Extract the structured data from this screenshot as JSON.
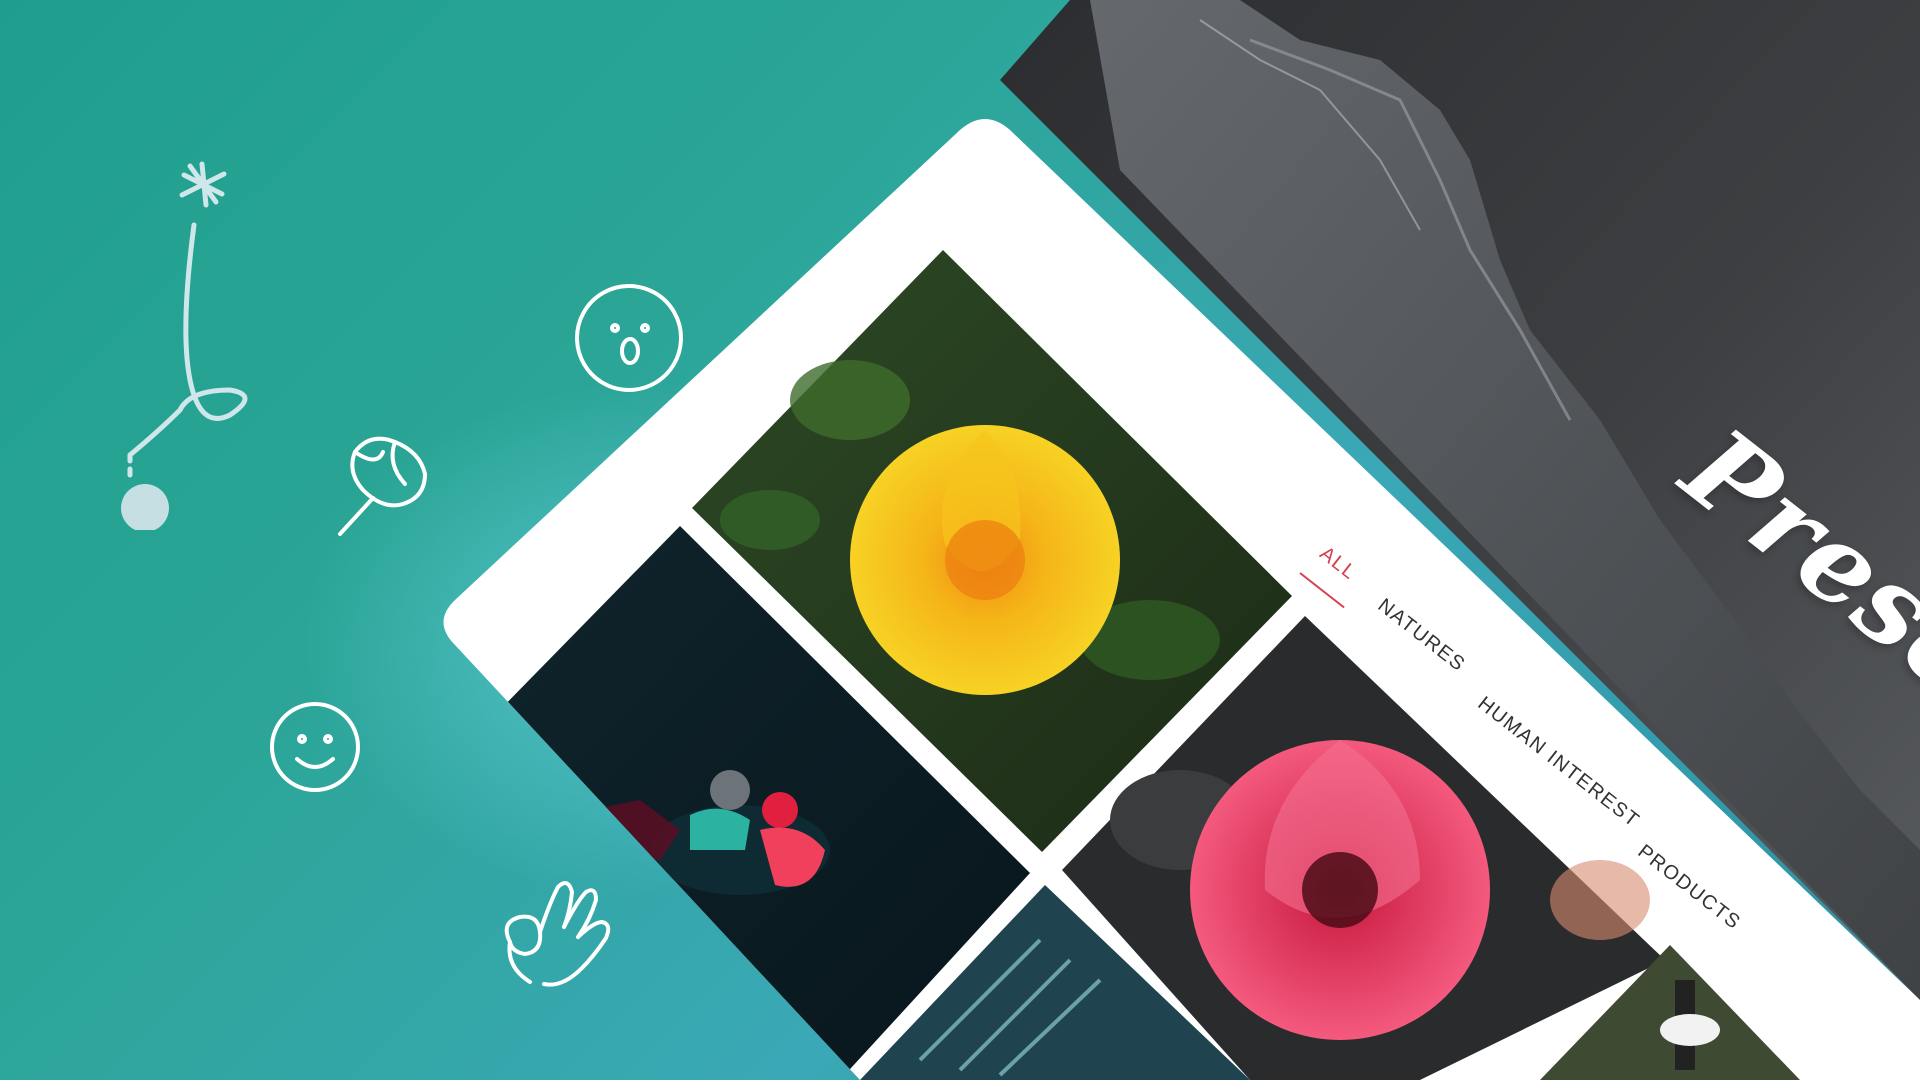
{
  "hero": {
    "title": "Presents"
  },
  "gallery": {
    "tabs": [
      {
        "label": "ALL",
        "active": true
      },
      {
        "label": "NATURES",
        "active": false
      },
      {
        "label": "HUMAN INTEREST",
        "active": false
      },
      {
        "label": "PRODUCTS",
        "active": false
      }
    ],
    "photos": [
      {
        "subject": "yellow-rose"
      },
      {
        "subject": "scooter-riders"
      },
      {
        "subject": "pink-rose"
      },
      {
        "subject": "machinery"
      },
      {
        "subject": "potted-plant"
      }
    ]
  },
  "doodles": [
    "sparkle-trail-icon",
    "surprised-face-icon",
    "flower-bud-icon",
    "smiley-face-icon",
    "ok-hand-icon"
  ],
  "colors": {
    "background_teal": "#2aa595",
    "accent_red": "#d6404e",
    "panel_dark": "#3a3c3f",
    "white": "#ffffff"
  }
}
